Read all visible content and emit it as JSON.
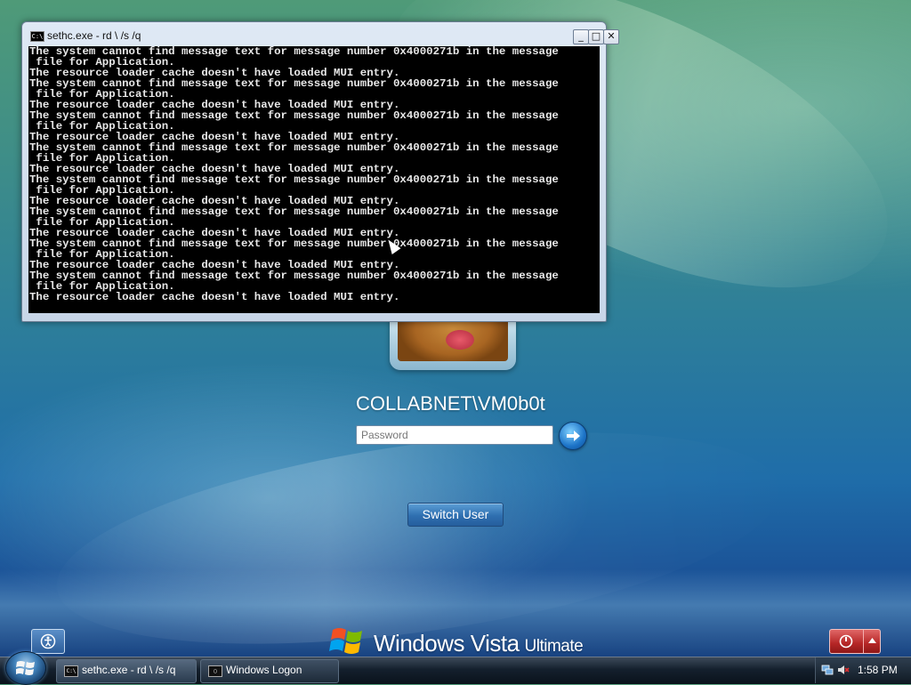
{
  "console_window": {
    "title": "sethc.exe - rd \\ /s /q",
    "icon_label": "C:\\",
    "lines": [
      "The system cannot find message text for message number 0x4000271b in the message",
      " file for Application.",
      "The resource loader cache doesn't have loaded MUI entry.",
      "The system cannot find message text for message number 0x4000271b in the message",
      " file for Application.",
      "The resource loader cache doesn't have loaded MUI entry.",
      "The system cannot find message text for message number 0x4000271b in the message",
      " file for Application.",
      "The resource loader cache doesn't have loaded MUI entry.",
      "The system cannot find message text for message number 0x4000271b in the message",
      " file for Application.",
      "The resource loader cache doesn't have loaded MUI entry.",
      "The system cannot find message text for message number 0x4000271b in the message",
      " file for Application.",
      "The resource loader cache doesn't have loaded MUI entry.",
      "The system cannot find message text for message number 0x4000271b in the message",
      " file for Application.",
      "The resource loader cache doesn't have loaded MUI entry.",
      "The system cannot find message text for message number 0x4000271b in the message",
      " file for Application.",
      "The resource loader cache doesn't have loaded MUI entry.",
      "The system cannot find message text for message number 0x4000271b in the message",
      " file for Application.",
      "The resource loader cache doesn't have loaded MUI entry."
    ],
    "buttons": {
      "minimize": "_",
      "maximize": "□",
      "close": "✕"
    }
  },
  "logon": {
    "username": "COLLABNET\\VM0b0t",
    "password_placeholder": "Password",
    "switch_user_label": "Switch User"
  },
  "brand": {
    "name": "Windows Vista",
    "edition": "Ultimate"
  },
  "taskbar": {
    "items": [
      {
        "label": "sethc.exe - rd \\ /s /q",
        "icon": "console-icon",
        "icon_label": "C:\\"
      },
      {
        "label": "Windows Logon",
        "icon": "window-icon",
        "icon_label": "▢"
      }
    ],
    "clock": "1:58 PM"
  },
  "colors": {
    "console_bg": "#000000",
    "console_text": "#e8e8e8",
    "shutdown_red": "#b52626",
    "switch_user_blue": "#2f6fb0"
  }
}
